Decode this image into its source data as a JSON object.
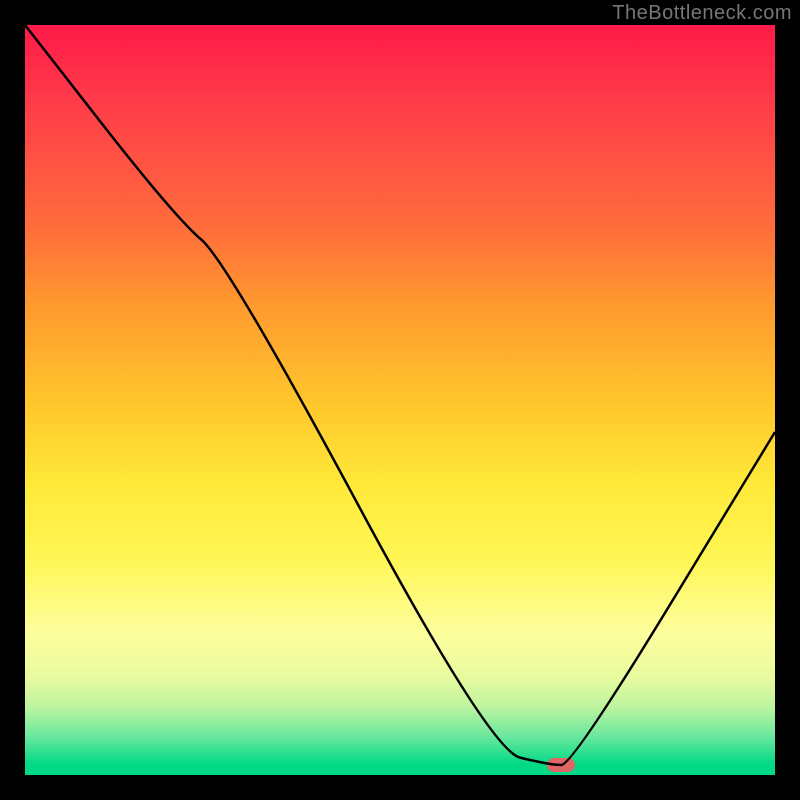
{
  "attribution": "TheBottleneck.com",
  "chart_data": {
    "type": "line",
    "title": "",
    "xlabel": "",
    "ylabel": "",
    "xlim": [
      0,
      100
    ],
    "ylim": [
      0,
      100
    ],
    "x": [
      0,
      20,
      27,
      62,
      70,
      73,
      100
    ],
    "values": [
      100,
      74,
      68,
      2,
      0,
      0,
      45
    ],
    "marker": {
      "x": 71.5,
      "y": 0
    },
    "gradient": {
      "stops": [
        {
          "at": 0,
          "color": "#ff1a47"
        },
        {
          "at": 10,
          "color": "#ff3a4a"
        },
        {
          "at": 28,
          "color": "#ff6f3b"
        },
        {
          "at": 38,
          "color": "#ff9a2e"
        },
        {
          "at": 52,
          "color": "#ffc92c"
        },
        {
          "at": 62,
          "color": "#ffe93a"
        },
        {
          "at": 72,
          "color": "#fff654"
        },
        {
          "at": 82,
          "color": "#fefe9c"
        },
        {
          "at": 88,
          "color": "#e9fa9f"
        },
        {
          "at": 92,
          "color": "#bff59f"
        },
        {
          "at": 96,
          "color": "#6de89e"
        },
        {
          "at": 100,
          "color": "#00d985"
        }
      ]
    },
    "grid": false,
    "legend": false
  }
}
